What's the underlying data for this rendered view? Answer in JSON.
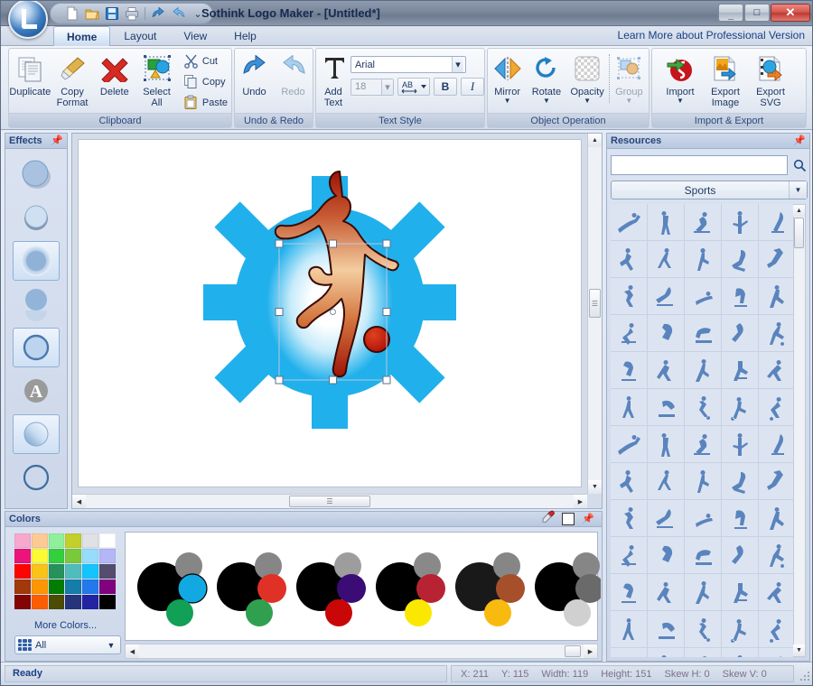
{
  "window": {
    "title": "Sothink Logo Maker - [Untitled*]",
    "minimize_label": "–",
    "maximize_label": "□",
    "close_label": "✕"
  },
  "quick_access": [
    {
      "name": "new-document",
      "icon": "page-icon",
      "label": "New"
    },
    {
      "name": "open-document",
      "icon": "folder-icon",
      "label": "Open"
    },
    {
      "name": "save-document",
      "icon": "floppy-icon",
      "label": "Save"
    },
    {
      "name": "print-document",
      "icon": "printer-icon",
      "label": "Print"
    },
    {
      "name": "undo-quick",
      "icon": "undo-arrow-icon",
      "label": "Undo"
    },
    {
      "name": "redo-quick",
      "icon": "redo-arrow-icon",
      "label": "Redo"
    }
  ],
  "qat_overflow_label": "⌄",
  "tabs": [
    {
      "label": "Home",
      "active": true
    },
    {
      "label": "Layout",
      "active": false
    },
    {
      "label": "View",
      "active": false
    },
    {
      "label": "Help",
      "active": false
    }
  ],
  "learn_more_link": "Learn More about Professional Version",
  "ribbon": {
    "groups": [
      {
        "title": "Clipboard",
        "big_buttons": [
          {
            "label": "Duplicate",
            "icon": "duplicate-pages-icon",
            "disabled": false
          },
          {
            "label": "Copy\nFormat",
            "label_l1": "Copy",
            "label_l2": "Format",
            "icon": "paintbrush-icon",
            "disabled": false
          },
          {
            "label": "Delete",
            "icon": "red-x-icon",
            "disabled": false
          },
          {
            "label": "Select\nAll",
            "label_l1": "Select",
            "label_l2": "All",
            "icon": "select-all-icon",
            "disabled": false
          }
        ],
        "small_buttons": [
          {
            "label": "Cut",
            "icon": "scissors-icon"
          },
          {
            "label": "Copy",
            "icon": "copy-icon"
          },
          {
            "label": "Paste",
            "icon": "clipboard-icon"
          }
        ]
      },
      {
        "title": "Undo & Redo",
        "big_buttons": [
          {
            "label": "Undo",
            "icon": "undo-arrow-icon",
            "disabled": false
          },
          {
            "label": "Redo",
            "icon": "redo-arrow-icon",
            "disabled": true
          }
        ]
      },
      {
        "title": "Text Style",
        "big_buttons": [
          {
            "label_l1": "Add",
            "label_l2": "Text",
            "icon": "big-t-icon",
            "disabled": false
          }
        ],
        "font_family": "Arial",
        "font_size": "18",
        "char_spacing_label": "AB",
        "bold_label": "B",
        "italic_label": "I"
      },
      {
        "title": "Object Operation",
        "big_buttons": [
          {
            "label": "Mirror",
            "icon": "mirror-icon",
            "disabled": false,
            "dropdown": true
          },
          {
            "label": "Rotate",
            "icon": "rotate-icon",
            "disabled": false,
            "dropdown": true
          },
          {
            "label": "Opacity",
            "icon": "checker-opacity-icon",
            "disabled": false,
            "dropdown": true
          },
          {
            "label": "Group",
            "icon": "group-icon",
            "disabled": true,
            "dropdown": true
          }
        ]
      },
      {
        "title": "Import & Export",
        "big_buttons": [
          {
            "label": "Import",
            "icon": "flash-import-icon",
            "disabled": false,
            "dropdown": true
          },
          {
            "label_l1": "Export",
            "label_l2": "Image",
            "icon": "export-image-icon",
            "disabled": false
          },
          {
            "label_l1": "Export",
            "label_l2": "SVG",
            "icon": "export-svg-icon",
            "disabled": false
          }
        ]
      }
    ]
  },
  "effects_panel": {
    "title": "Effects",
    "pin_icon": "pin-icon",
    "items": [
      {
        "name": "effect-drop-shadow",
        "selected": false
      },
      {
        "name": "effect-inner-shadow",
        "selected": false
      },
      {
        "name": "effect-glow",
        "selected": true
      },
      {
        "name": "effect-reflection",
        "selected": false
      },
      {
        "name": "effect-stroke",
        "selected": true
      },
      {
        "name": "effect-text-mask",
        "selected": false
      },
      {
        "name": "effect-gradient",
        "selected": true
      },
      {
        "name": "effect-outline",
        "selected": false
      }
    ]
  },
  "canvas": {
    "logo_name": "soccer-player-gear-logo",
    "gear_color": "#20b0ec",
    "figure_gradient_from": "#9e1508",
    "figure_gradient_to": "#f7c998",
    "ball_color": "#c41a12",
    "selection_handles": 8
  },
  "colors_panel": {
    "title": "Colors",
    "eyedropper_icon": "eyedropper-icon",
    "current_color": "#ffffff",
    "pin_icon": "pin-icon",
    "more_colors_label": "More Colors...",
    "filter_label": "All",
    "swatch_rows": [
      [
        "#f7a8cd",
        "#fcca94",
        "#90ef9b",
        "#c3cf2a",
        "#e0e1e4",
        "#ffffff"
      ],
      [
        "#ed137a",
        "#fcfa32",
        "#34cf3d",
        "#7ac93a",
        "#96dcfb",
        "#b4b6f6"
      ],
      [
        "#fb0402",
        "#fac31a",
        "#27915b",
        "#52bbbb",
        "#14c5fd",
        "#544d6e"
      ],
      [
        "#a1390b",
        "#fd9602",
        "#017e01",
        "#167ca9",
        "#2279ea",
        "#81027f"
      ],
      [
        "#820403",
        "#fd5d01",
        "#4c4c03",
        "#26347a",
        "#2323a4",
        "#000000"
      ]
    ],
    "palettes": [
      {
        "big": "#000000",
        "top": "#868686",
        "right": "#12a9e3",
        "bottom": "#11a055",
        "selected": true
      },
      {
        "big": "#000000",
        "top": "#868686",
        "right": "#e03127",
        "bottom": "#30a050",
        "selected": false
      },
      {
        "big": "#000000",
        "top": "#9d9d9d",
        "right": "#3b0b76",
        "bottom": "#c90707",
        "selected": false
      },
      {
        "big": "#000000",
        "top": "#898989",
        "right": "#b82334",
        "bottom": "#fae800",
        "selected": false
      },
      {
        "big": "#191919",
        "top": "#868686",
        "right": "#a5502b",
        "bottom": "#f9ba10",
        "selected": false
      },
      {
        "big": "#000000",
        "top": "#868686",
        "right": "#6a6a6a",
        "bottom": "#d0d0d0",
        "selected": false
      }
    ]
  },
  "resources_panel": {
    "title": "Resources",
    "pin_icon": "pin-icon",
    "search_placeholder": "",
    "search_value": "",
    "search_icon": "search-icon",
    "category": "Sports",
    "category_arrow_icon": "chevron-down-icon",
    "items": [
      "ski-jump",
      "ski-aerial",
      "downhill-ski",
      "biathlon",
      "ski-jumper",
      "figure-skate-spin",
      "figure-skater",
      "figure-skate-pose",
      "snowboard-jump",
      "cross-country-ski",
      "speed-skate",
      "slalom-ski",
      "ski-slide",
      "snowboard-grab",
      "pole-vault",
      "skateboard-trick",
      "snowboarder",
      "skate-ramp",
      "skate-flip",
      "soccer-kick",
      "skate-air",
      "bmx-rider",
      "gymnast-kick",
      "vault-gym",
      "baseball-swing",
      "runner",
      "cyclist",
      "sprinter",
      "soccer-volley",
      "soccer-dribble",
      "soccer-run",
      "soccer-tackle",
      "soccer-strike",
      "soccer-shot",
      "soccer-keeper",
      "soccer-pass",
      "soccer-header",
      "soccer-slide",
      "soccer-jump",
      "soccer-stand",
      "soccer-control",
      "soccer-trap",
      "soccer-sprint",
      "cheer-jump",
      "dancer-leap",
      "soccer-shoot",
      "star-jump",
      "ballroom-dress",
      "dancer-pose",
      "dancer-arms",
      "ballet-split",
      "ballet-stand",
      "dance-kick",
      "dance-bend",
      "ballet-arabesque",
      "dance-leap",
      "dance-pose",
      "dance-reach",
      "dance-twist",
      "dance-dive",
      "dance-low",
      "dance-slide",
      "dance-floor",
      "dance-spin",
      "dance-duo"
    ]
  },
  "statusbar": {
    "message": "Ready",
    "fields": [
      {
        "label": "X:",
        "value": "211"
      },
      {
        "label": "Y:",
        "value": "115"
      },
      {
        "label": "Width:",
        "value": "119"
      },
      {
        "label": "Height:",
        "value": "151"
      },
      {
        "label": "Skew H:",
        "value": "0"
      },
      {
        "label": "Skew V:",
        "value": "0"
      }
    ]
  }
}
